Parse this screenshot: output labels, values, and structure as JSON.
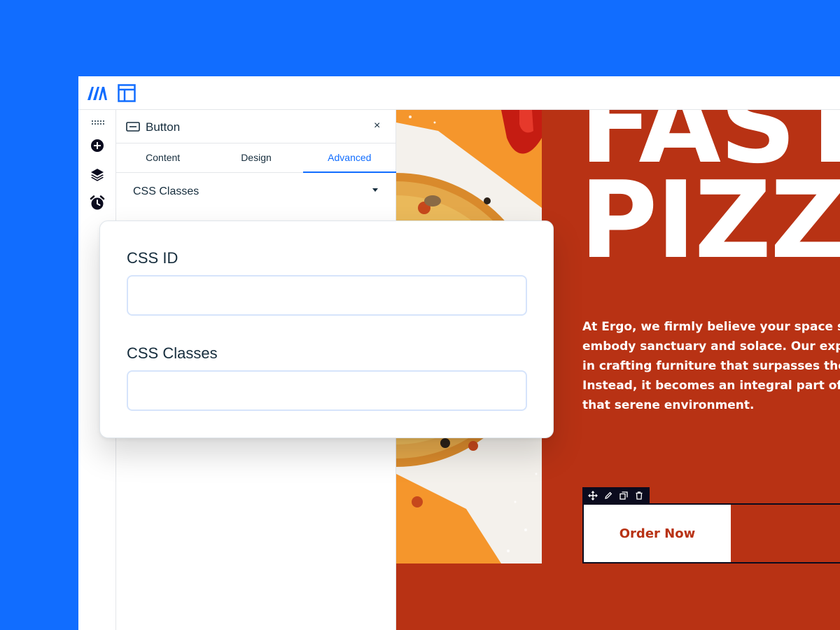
{
  "colors": {
    "accent": "#116dff",
    "canvas_bg": "#b83214",
    "text_dark": "#162d3d",
    "toolbar_bg": "#0b0b1e"
  },
  "topbar": {
    "logo_icon": "wix-logo-icon",
    "layout_icon": "page-layout-icon"
  },
  "leftrail": {
    "items": [
      {
        "icon": "drag-handle-icon"
      },
      {
        "icon": "add-icon"
      },
      {
        "icon": "layers-icon"
      },
      {
        "icon": "alarm-clock-icon"
      }
    ]
  },
  "panel": {
    "title": "Button",
    "close_label": "×",
    "tabs": [
      {
        "label": "Content",
        "active": false
      },
      {
        "label": "Design",
        "active": false
      },
      {
        "label": "Advanced",
        "active": true
      }
    ],
    "section_label": "CSS Classes"
  },
  "popup": {
    "css_id_label": "CSS ID",
    "css_id_value": "",
    "css_classes_label": "CSS Classes",
    "css_classes_value": ""
  },
  "canvas": {
    "headline": "FAST\nPIZZA",
    "body": "At Ergo, we firmly believe your space should\nembody sanctuary and solace. Our expertise lies\nin crafting furniture that surpasses the ordinary.\nInstead, it becomes an integral part of\nthat serene environment.",
    "order_button_label": "Order Now",
    "toolbar_tools": [
      "move-icon",
      "edit-pencil-icon",
      "duplicate-icon",
      "delete-icon"
    ]
  }
}
